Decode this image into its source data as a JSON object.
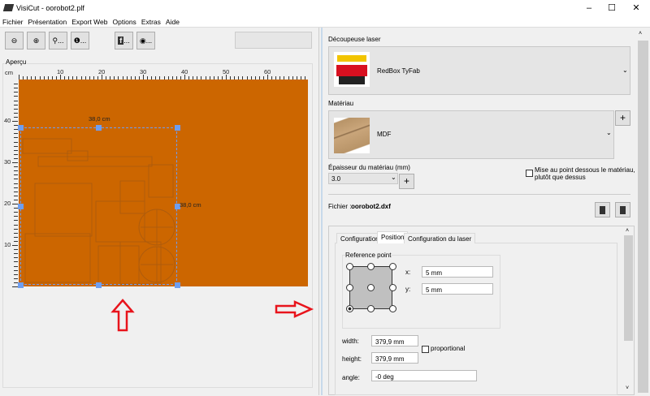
{
  "window": {
    "title": "VisiCut - oorobot2.plf",
    "controls": [
      "minimize",
      "maximize",
      "close"
    ]
  },
  "menu": [
    "Fichier",
    "Présentation",
    "Export Web",
    "Options",
    "Extras",
    "Aide"
  ],
  "toolbar": [
    {
      "icon": "zoom-out-icon",
      "label": ""
    },
    {
      "icon": "zoom-in-icon",
      "label": ""
    },
    {
      "icon": "zoom-fit-icon",
      "label": "..."
    },
    {
      "icon": "zoom-100-icon",
      "label": "..."
    },
    {
      "icon": "facebook-icon",
      "label": "..."
    },
    {
      "icon": "qr-icon",
      "label": "..."
    }
  ],
  "preview": {
    "title": "Aperçu",
    "unit": "cm",
    "x_ticks": [
      "10",
      "20",
      "30",
      "40",
      "50",
      "60"
    ],
    "y_ticks": [
      "40",
      "30",
      "20",
      "10"
    ],
    "width_label": "38,0 cm",
    "height_label": "38,0 cm",
    "bed_color": "#cc6600",
    "selection_color": "#6e9ef0",
    "arrow_color": "#e8141c"
  },
  "laser": {
    "label": "Découpeuse laser",
    "selected": "RedBox TyFab"
  },
  "material": {
    "label": "Matériau",
    "selected": "MDF",
    "add": "+"
  },
  "thickness": {
    "label": "Épaisseur du matériau (mm)",
    "value": "3.0",
    "add": "+"
  },
  "focus": {
    "label": "Mise au point dessous le matériau, plutôt que dessus",
    "checked": false
  },
  "file": {
    "label": "Fichier :",
    "name": "oorobot2.dxf"
  },
  "tabs": [
    {
      "label": "Configuration",
      "active": false
    },
    {
      "label": "Position",
      "active": true
    },
    {
      "label": "Configuration du laser",
      "active": false
    }
  ],
  "position": {
    "ref_title": "Reference point",
    "ref_selected": "bottom-left",
    "x_label": "x:",
    "x_value": "5 mm",
    "y_label": "y:",
    "y_value": "5 mm",
    "width_label": "width:",
    "width_value": "379,9 mm",
    "height_label": "height:",
    "height_value": "379,9 mm",
    "proportional_label": "proportional",
    "proportional": false,
    "angle_label": "angle:",
    "angle_value": "-0 deg"
  }
}
